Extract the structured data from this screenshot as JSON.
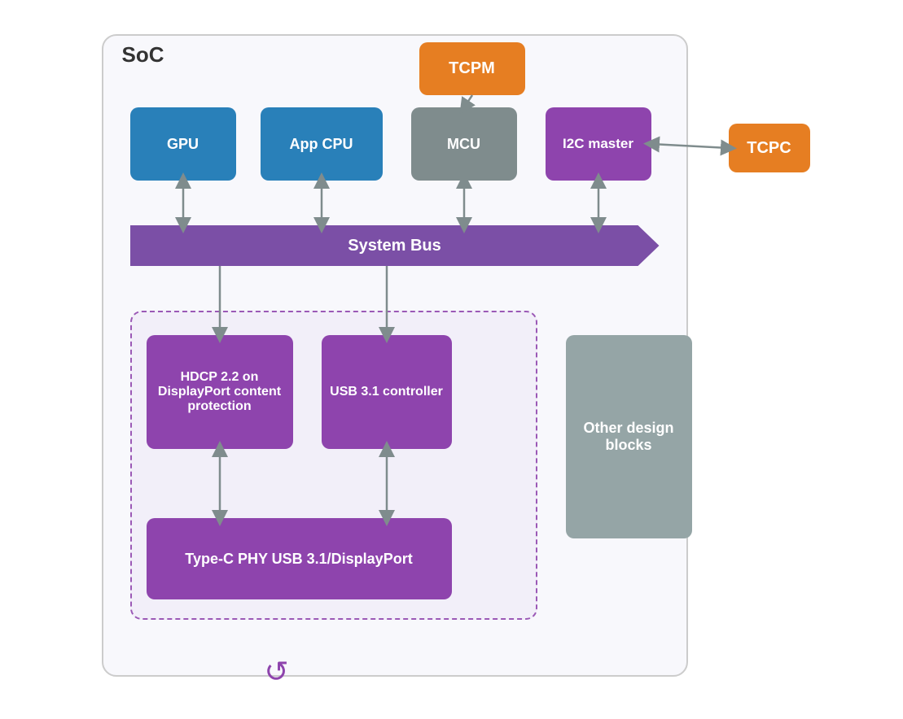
{
  "diagram": {
    "title": "SoC",
    "components": {
      "gpu": "GPU",
      "appcpu": "App CPU",
      "tcpm": "TCPM",
      "mcu": "MCU",
      "i2c": "I2C master",
      "tcpc": "TCPC",
      "systembus": "System Bus",
      "hdcp": "HDCP 2.2 on DisplayPort content protection",
      "usb31": "USB 3.1 controller",
      "typeC": "Type-C PHY USB 3.1/DisplayPort",
      "other": "Other design blocks"
    },
    "colors": {
      "blue": "#2980b9",
      "orange": "#e67e22",
      "gray": "#7f8c8d",
      "purple": "#8e44ad",
      "purple_bus": "#7b4fa6",
      "arrow": "#7f8c8d",
      "dashed_border": "#9b59b6"
    }
  }
}
